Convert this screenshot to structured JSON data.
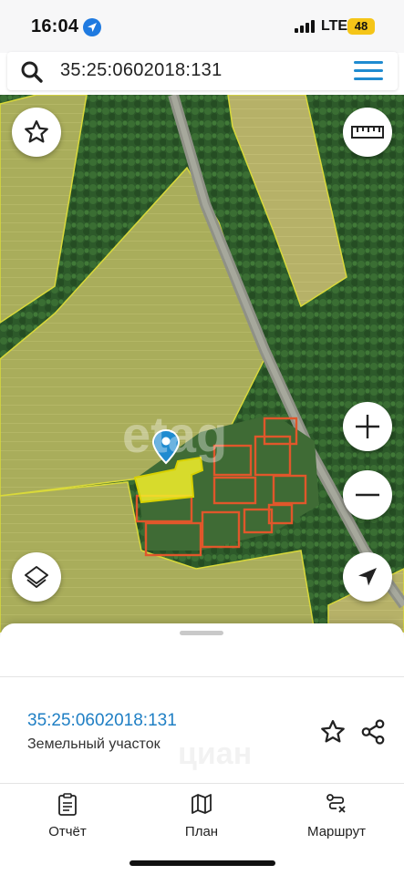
{
  "status_bar": {
    "time": "16:04",
    "network": "LTE",
    "battery": "48"
  },
  "search": {
    "query": "35:25:0602018:131"
  },
  "map": {
    "watermark": "etag",
    "buttons": [
      "favorite-star",
      "ruler",
      "zoom-in",
      "zoom-out",
      "layers",
      "my-location"
    ]
  },
  "sheet": {
    "parcel_id": "35:25:0602018:131",
    "parcel_type": "Земельный участок",
    "ghost_text": "циан"
  },
  "nav": [
    {
      "label": "Отчёт",
      "icon": "report-icon"
    },
    {
      "label": "План",
      "icon": "map-plan-icon"
    },
    {
      "label": "Маршрут",
      "icon": "route-icon"
    }
  ],
  "colors": {
    "accent": "#1f8bd0",
    "parcel_highlight": "#f2ee2a",
    "parcel_border": "#e0572b"
  }
}
